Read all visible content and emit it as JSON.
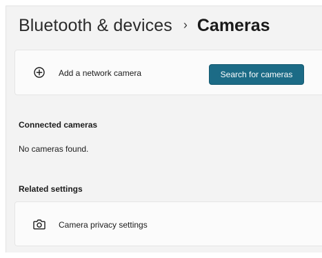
{
  "header": {
    "parent": "Bluetooth & devices",
    "separator": "›",
    "current": "Cameras"
  },
  "network_camera": {
    "icon": "plus-circle-icon",
    "label": "Add a network camera",
    "button_label": "Search for cameras",
    "button_color": "#1c6b86"
  },
  "connected": {
    "heading": "Connected cameras",
    "empty_text": "No cameras found."
  },
  "related": {
    "heading": "Related settings",
    "items": [
      {
        "icon": "camera-icon",
        "label": "Camera privacy settings"
      }
    ]
  }
}
